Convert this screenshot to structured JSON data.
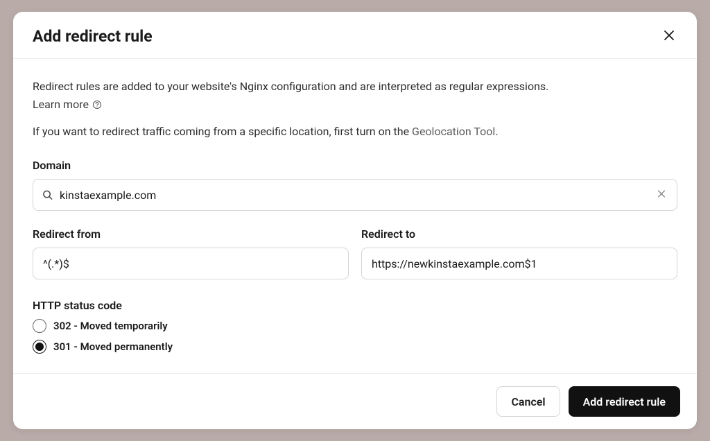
{
  "header": {
    "title": "Add redirect rule"
  },
  "body": {
    "description": "Redirect rules are added to your website's Nginx configuration and are interpreted as regular expressions.",
    "learn_more": "Learn more",
    "geo_prefix": "If you want to redirect traffic coming from a specific location, first turn on the ",
    "geo_link": "Geolocation Tool",
    "geo_suffix": "."
  },
  "domain": {
    "label": "Domain",
    "value": "kinstaexample.com"
  },
  "redirect_from": {
    "label": "Redirect from",
    "value": "^(.*)$"
  },
  "redirect_to": {
    "label": "Redirect to",
    "value": "https://newkinstaexample.com$1"
  },
  "status_code": {
    "label": "HTTP status code",
    "options": [
      {
        "label": "302 - Moved temporarily",
        "selected": false
      },
      {
        "label": "301 - Moved permanently",
        "selected": true
      }
    ]
  },
  "footer": {
    "cancel": "Cancel",
    "submit": "Add redirect rule"
  }
}
